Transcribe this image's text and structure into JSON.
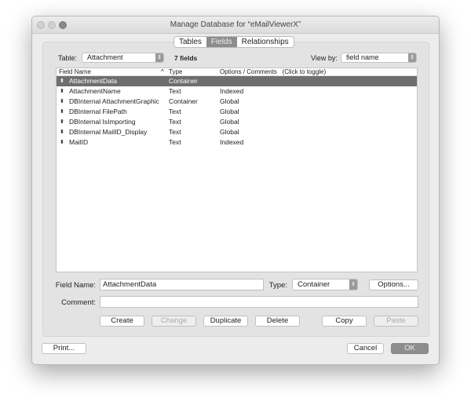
{
  "window": {
    "title": "Manage Database for “eMailViewerX”"
  },
  "tabs": [
    {
      "label": "Tables",
      "selected": false
    },
    {
      "label": "Fields",
      "selected": true
    },
    {
      "label": "Relationships",
      "selected": false
    }
  ],
  "table_label": "Table:",
  "table_value": "Attachment",
  "field_count": "7 fields",
  "viewby_label": "View by:",
  "viewby_value": "field name",
  "columns": {
    "name": "Field Name",
    "type": "Type",
    "options": "Options / Comments   (Click to toggle)"
  },
  "rows": [
    {
      "name": "AttachmentData",
      "type": "Container",
      "options": ""
    },
    {
      "name": "AttachmentName",
      "type": "Text",
      "options": "Indexed"
    },
    {
      "name": "DBInternal AttachmentGraphic",
      "type": "Container",
      "options": "Global"
    },
    {
      "name": "DBInternal FilePath",
      "type": "Text",
      "options": "Global"
    },
    {
      "name": "DBInternal IsImporting",
      "type": "Text",
      "options": "Global"
    },
    {
      "name": "DBInternal MailID_Display",
      "type": "Text",
      "options": "Global"
    },
    {
      "name": "MailID",
      "type": "Text",
      "options": "Indexed"
    }
  ],
  "form": {
    "field_name_label": "Field Name:",
    "field_name_value": "AttachmentData",
    "type_label": "Type:",
    "type_value": "Container",
    "options_button": "Options...",
    "comment_label": "Comment:",
    "comment_value": ""
  },
  "buttons": {
    "create": "Create",
    "change": "Change",
    "duplicate": "Duplicate",
    "delete": "Delete",
    "copy": "Copy",
    "paste": "Paste",
    "print": "Print...",
    "cancel": "Cancel",
    "ok": "OK"
  }
}
